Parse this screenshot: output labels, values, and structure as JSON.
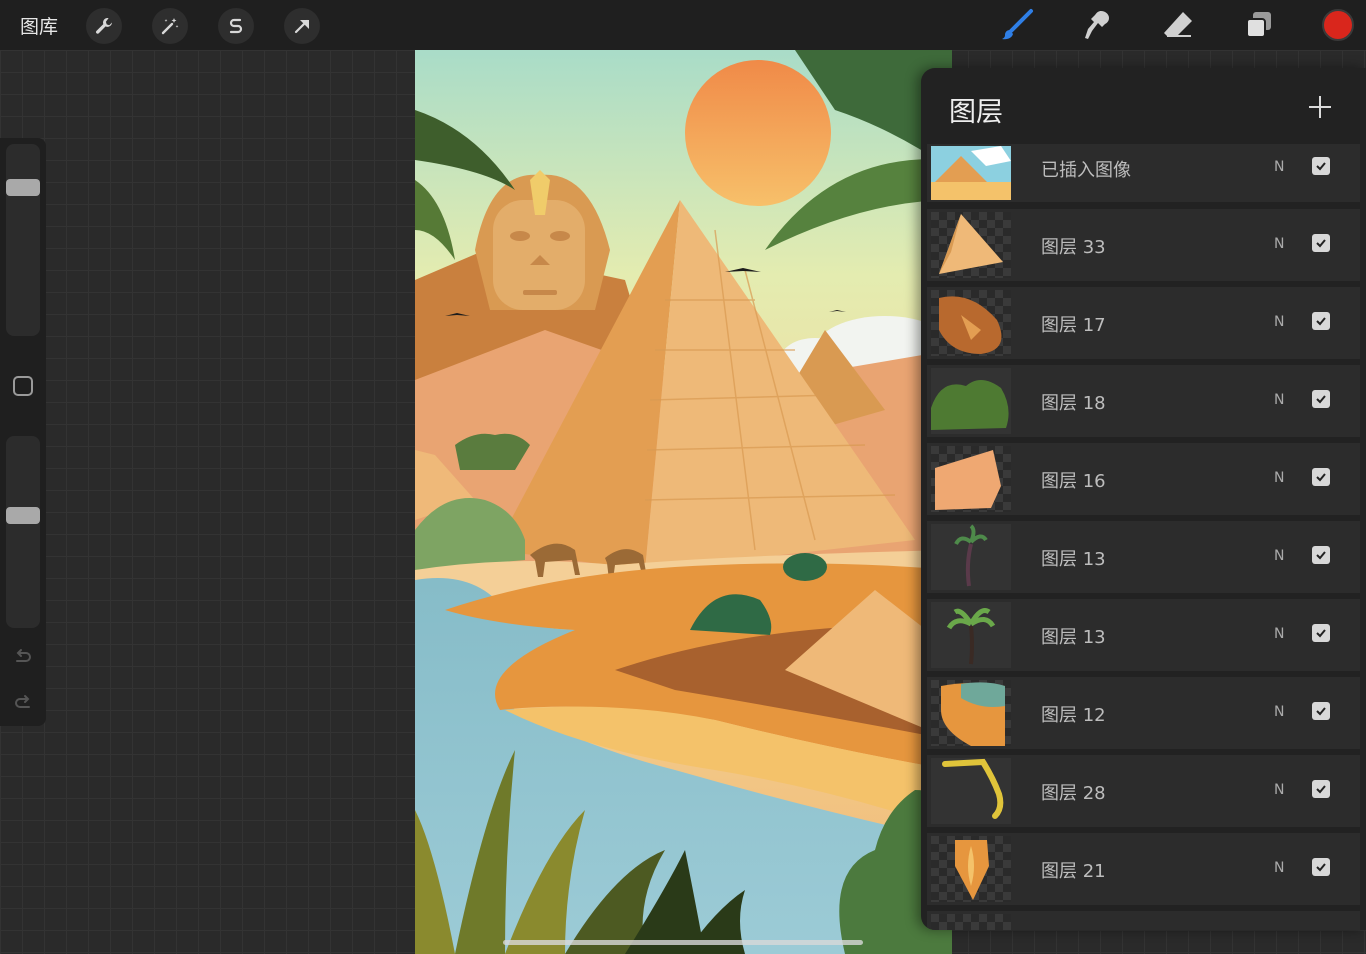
{
  "toolbar": {
    "gallery_label": "图库",
    "left_tools": [
      "wrench-icon",
      "magic-wand-icon",
      "selection-s-icon",
      "transform-arrow-icon"
    ],
    "right_tools": [
      "brush-icon",
      "smudge-icon",
      "eraser-icon",
      "layers-icon"
    ],
    "current_color": "#d9261c"
  },
  "layers_panel": {
    "title": "图层",
    "layers": [
      {
        "name": "已插入图像",
        "blend": "N",
        "visible": true
      },
      {
        "name": "图层 33",
        "blend": "N",
        "visible": true
      },
      {
        "name": "图层 17",
        "blend": "N",
        "visible": true
      },
      {
        "name": "图层 18",
        "blend": "N",
        "visible": true
      },
      {
        "name": "图层 16",
        "blend": "N",
        "visible": true
      },
      {
        "name": "图层 13",
        "blend": "N",
        "visible": true
      },
      {
        "name": "图层 13",
        "blend": "N",
        "visible": true
      },
      {
        "name": "图层 12",
        "blend": "N",
        "visible": true
      },
      {
        "name": "图层 28",
        "blend": "N",
        "visible": true
      },
      {
        "name": "图层 21",
        "blend": "N",
        "visible": true
      }
    ]
  },
  "sidebar": {
    "brush_size_level": 0.22,
    "opacity_level": 0.42
  }
}
